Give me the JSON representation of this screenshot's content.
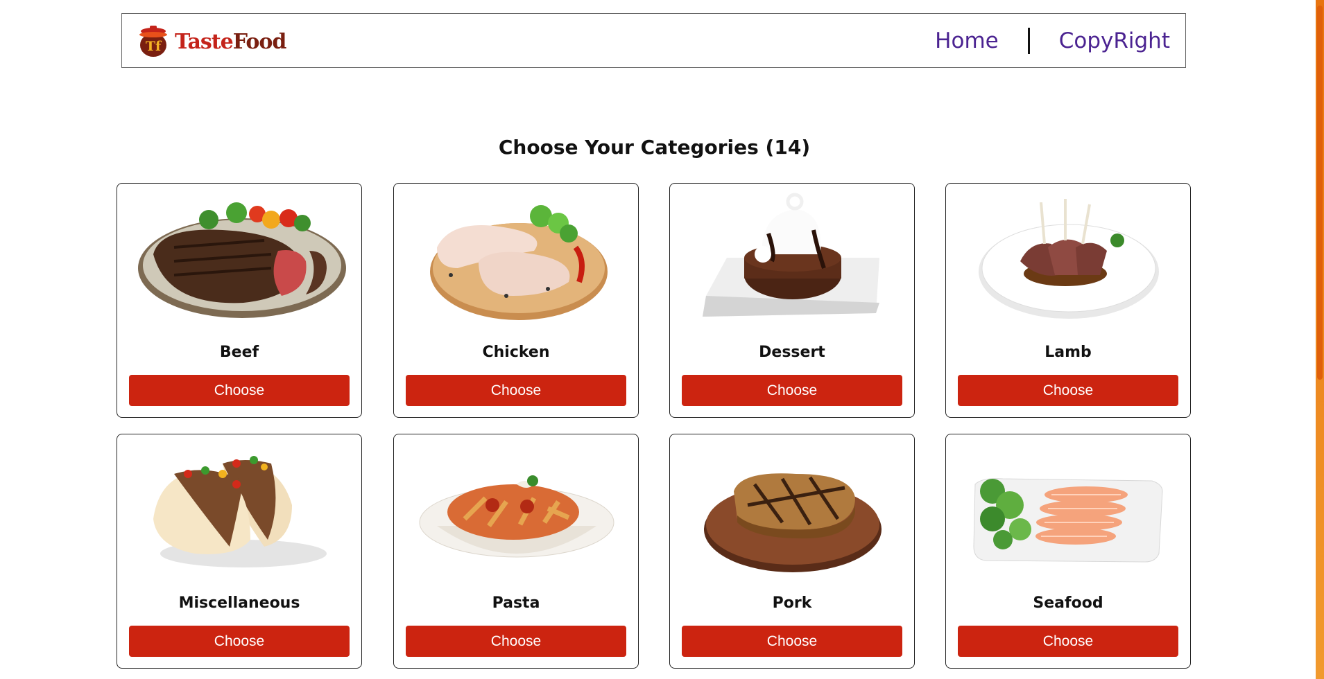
{
  "brand": {
    "word1": "Taste",
    "word2": "Food",
    "mark": "Tf"
  },
  "nav": {
    "home": "Home",
    "copyright": "CopyRight"
  },
  "page_title": "Choose Your Categories (14)",
  "cards": [
    {
      "name": "Beef",
      "button": "Choose",
      "icon": "steak-image"
    },
    {
      "name": "Chicken",
      "button": "Choose",
      "icon": "chicken-image"
    },
    {
      "name": "Dessert",
      "button": "Choose",
      "icon": "dessert-image"
    },
    {
      "name": "Lamb",
      "button": "Choose",
      "icon": "lamb-image"
    },
    {
      "name": "Miscellaneous",
      "button": "Choose",
      "icon": "taco-image"
    },
    {
      "name": "Pasta",
      "button": "Choose",
      "icon": "pasta-image"
    },
    {
      "name": "Pork",
      "button": "Choose",
      "icon": "pork-image"
    },
    {
      "name": "Seafood",
      "button": "Choose",
      "icon": "seafood-image"
    }
  ],
  "colors": {
    "accent": "#cc2410",
    "nav_link": "#4b2391",
    "scrollbar": "#e8740f"
  }
}
